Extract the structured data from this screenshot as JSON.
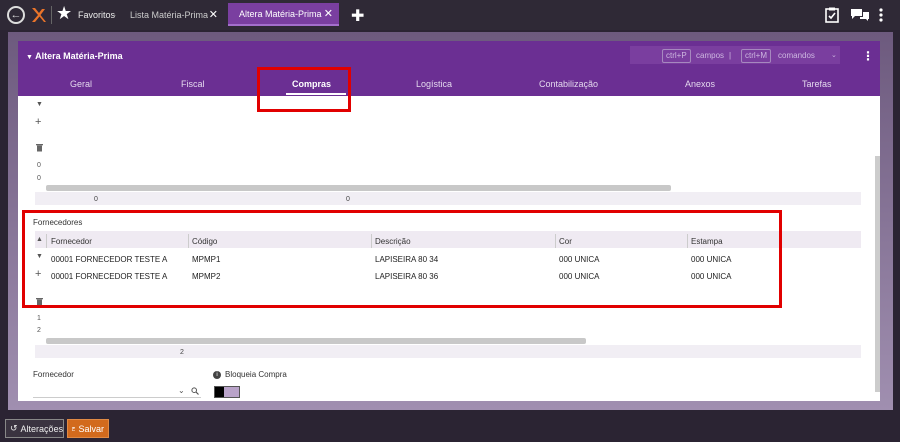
{
  "topbar": {
    "favorites_label": "Favoritos",
    "favorites_sep": "-",
    "tabs": [
      {
        "label": "Lista Matéria-Prima",
        "close": "✕"
      },
      {
        "label": "Altera Matéria-Prima",
        "close": "✕"
      }
    ],
    "add_tab": "✚"
  },
  "header": {
    "title": "Altera Matéria-Prima",
    "shortcut_fields_key": "ctrl+P",
    "shortcut_fields_label": "campos",
    "shortcut_divider": "|",
    "shortcut_commands_key": "ctrl+M",
    "shortcut_commands_label": "comandos",
    "menu": "⋮"
  },
  "nav": [
    "Geral",
    "Fiscal",
    "Compras",
    "Logística",
    "Contabilização",
    "Anexos",
    "Tarefas"
  ],
  "upper_grid": {
    "count_a": "0",
    "count_b": "0",
    "gutter_a": "0",
    "gutter_b": "0",
    "footer_a": "0",
    "footer_b": "0"
  },
  "fornecedores": {
    "section": "Fornecedores",
    "columns": [
      "Fornecedor",
      "Código",
      "Descrição",
      "Cor",
      "Estampa"
    ],
    "rows": [
      [
        "00001 FORNECEDOR TESTE A",
        "MPMP1",
        "LAPISEIRA 80 34",
        "000 UNICA",
        "000 UNICA"
      ],
      [
        "00001 FORNECEDOR TESTE A",
        "MPMP2",
        "LAPISEIRA 80 36",
        "000 UNICA",
        "000 UNICA"
      ]
    ],
    "gutter_1": "1",
    "gutter_2": "2",
    "footer_count": "2"
  },
  "form": {
    "fornecedor_label": "Fornecedor",
    "bloqueia_label": "Bloqueia Compra",
    "bloqueia_value": false
  },
  "bottombar": {
    "alteracoes": "Alterações",
    "salvar": "Salvar"
  },
  "colors": {
    "accent": "#6b2f93",
    "highlight": "#e10000",
    "save": "#d26a1d"
  }
}
